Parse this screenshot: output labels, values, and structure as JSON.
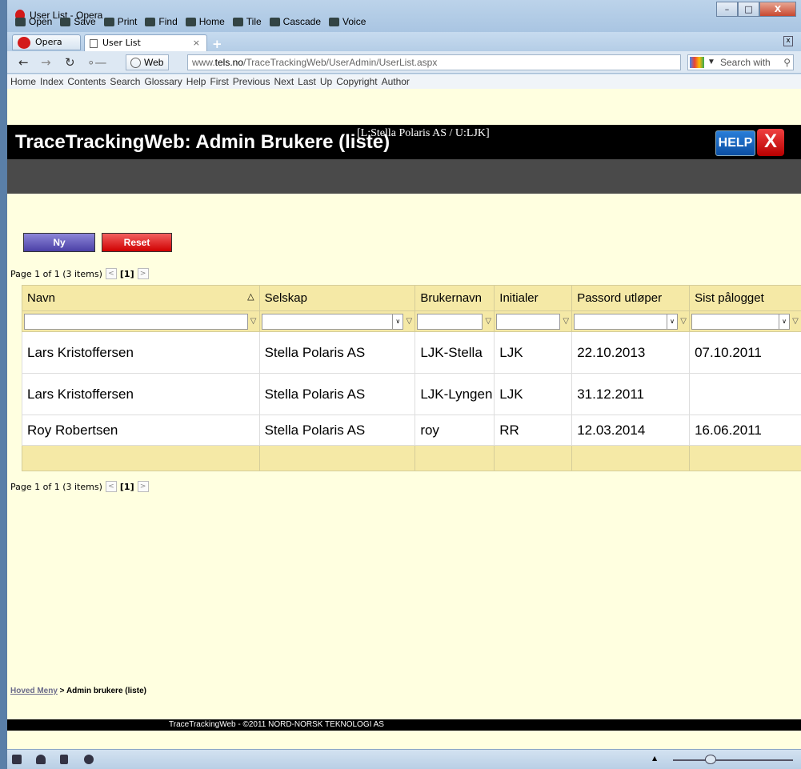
{
  "window": {
    "title": "User List - Opera",
    "controls": {
      "minimize": "–",
      "maximize": "□",
      "close": "X"
    }
  },
  "toolbar": [
    {
      "label": "Open",
      "icon": "folder-icon"
    },
    {
      "label": "Save",
      "icon": "save-icon"
    },
    {
      "label": "Print",
      "icon": "print-icon"
    },
    {
      "label": "Find",
      "icon": "find-icon"
    },
    {
      "label": "Home",
      "icon": "home-icon"
    },
    {
      "label": "Tile",
      "icon": "tile-icon"
    },
    {
      "label": "Cascade",
      "icon": "cascade-icon"
    },
    {
      "label": "Voice",
      "icon": "voice-icon"
    }
  ],
  "tabs": {
    "opera_menu": "Opera",
    "active_tab": "User List",
    "close_glyph": "×",
    "add_glyph": "+"
  },
  "address": {
    "web_label": "Web",
    "url_prefix": "www.",
    "url_host": "tels.no",
    "url_path": "/TraceTrackingWeb/UserAdmin/UserList.aspx",
    "search_placeholder": "Search with"
  },
  "nav_links": [
    "Home",
    "Index",
    "Contents",
    "Search",
    "Glossary",
    "Help",
    "First",
    "Previous",
    "Next",
    "Last",
    "Up",
    "Copyright",
    "Author"
  ],
  "app": {
    "title": "TraceTrackingWeb: Admin Brukere (liste)",
    "user_info": "[L:Stella Polaris AS / U:LJK]",
    "help_label": "HELP",
    "close_label": "X",
    "new_button": "Ny",
    "reset_button": "Reset"
  },
  "pager": {
    "summary": "Page 1 of 1 (3 items)",
    "prev": "<",
    "current": "[1]",
    "next": ">"
  },
  "grid": {
    "columns": [
      "Navn",
      "Selskap",
      "Brukernavn",
      "Initialer",
      "Passord utløper",
      "Sist pålogget"
    ],
    "sort_indicator": "△",
    "rows": [
      [
        "Lars Kristoffersen",
        "Stella Polaris AS",
        "LJK-Stella",
        "LJK",
        "22.10.2013",
        "07.10.2011"
      ],
      [
        "Lars Kristoffersen",
        "Stella Polaris AS",
        "LJK-Lyngen",
        "LJK",
        "31.12.2011",
        ""
      ],
      [
        "Roy Robertsen",
        "Stella Polaris AS",
        "roy",
        "RR",
        "12.03.2014",
        "16.06.2011"
      ]
    ]
  },
  "breadcrumb": {
    "link": "Hoved Meny",
    "separator": " > ",
    "current": "Admin brukere (liste)"
  },
  "footer": "TraceTrackingWeb - ©2011 NORD-NORSK TEKNOLOGI AS"
}
